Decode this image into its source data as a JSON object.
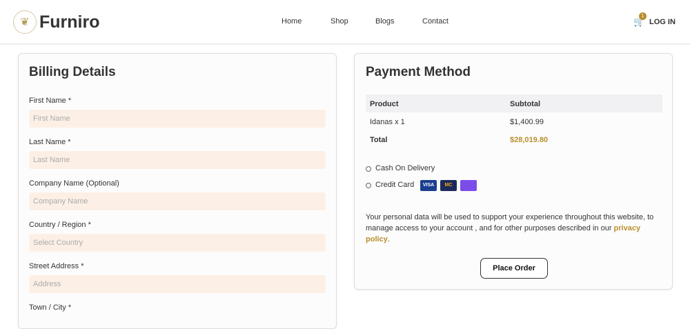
{
  "header": {
    "brand": "Furniro",
    "nav": [
      "Home",
      "Shop",
      "Blogs",
      "Contact"
    ],
    "cart_count": "1",
    "login": "LOG IN"
  },
  "billing": {
    "title": "Billing Details",
    "fields": [
      {
        "label": "First Name *",
        "placeholder": "First Name"
      },
      {
        "label": "Last Name *",
        "placeholder": "Last Name"
      },
      {
        "label": "Company Name (Optional)",
        "placeholder": "Company Name"
      },
      {
        "label": "Country / Region *",
        "placeholder": "Select Country"
      },
      {
        "label": "Street Address *",
        "placeholder": "Address"
      },
      {
        "label": "Town / City *"
      }
    ]
  },
  "payment": {
    "title": "Payment Method",
    "col_product": "Product",
    "col_subtotal": "Subtotal",
    "rows": [
      {
        "product": "Idanas x 1",
        "subtotal": "$1,400.99"
      }
    ],
    "total_label": "Total",
    "total": "$28,019.80",
    "methods": [
      "Cash On Delivery",
      "Credit Card"
    ],
    "cards": [
      "VISA",
      "MC",
      ""
    ],
    "note": "Your personal data will be used to support your experience throughout this website, to manage access to your account , and for other purposes described in our ",
    "policy_link": "privacy policy",
    "policy_end": ".",
    "place_order": "Place Order"
  },
  "colors": {
    "accent": "#b88e2f",
    "input_bg": "#fcf0e6"
  }
}
